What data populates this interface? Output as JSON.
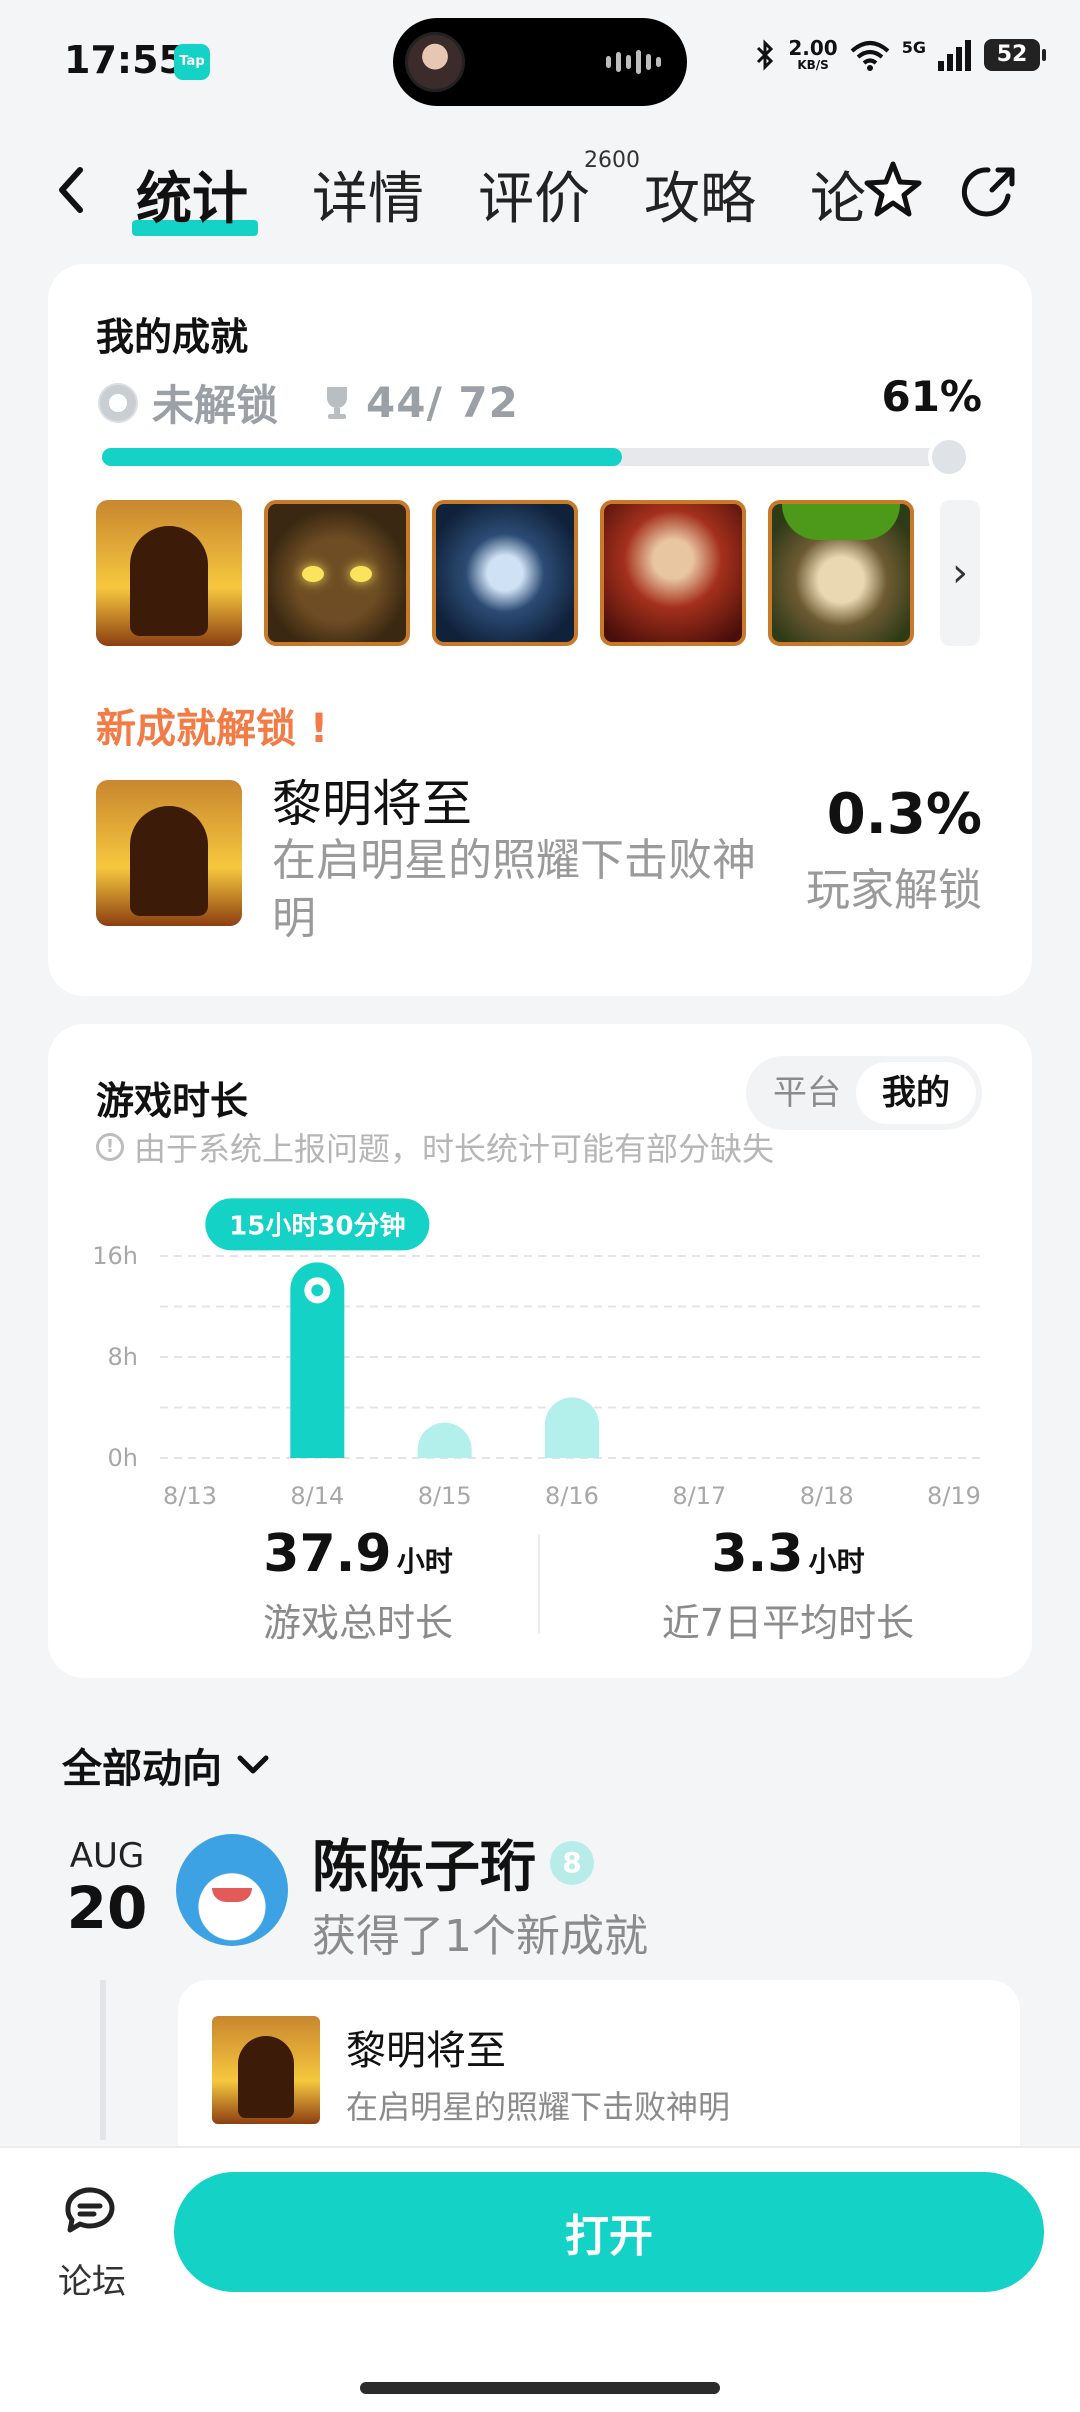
{
  "status_bar": {
    "time": "17:55",
    "app_badge": "Tap",
    "speed": "2.00",
    "speed_unit": "KB/S",
    "network": "5G",
    "battery": "52"
  },
  "nav": {
    "tabs": [
      "统计",
      "详情",
      "评价",
      "攻略",
      "论"
    ],
    "active_tab": "统计",
    "review_count": "2600"
  },
  "achievements": {
    "title": "我的成就",
    "status_label": "未解锁",
    "progress_text": "44/ 72",
    "percent_text": "61%",
    "progress_value": 0.61,
    "badges": [
      "dawn-badge",
      "golem-badge",
      "armor-badge",
      "staff-badge",
      "monkey-badge"
    ],
    "new_title": "新成就解锁 !",
    "new_name": "黎明将至",
    "new_desc": "在启明星的照耀下击败神明",
    "new_rate": "0.3%",
    "new_rate_label": "玩家解锁"
  },
  "playtime": {
    "title": "游戏时长",
    "toggle_off": "平台",
    "toggle_on": "我的",
    "notice": "由于系统上报问题，时长统计可能有部分缺失",
    "total_value": "37.9",
    "total_unit": "小时",
    "total_label": "游戏总时长",
    "avg_value": "3.3",
    "avg_unit": "小时",
    "avg_label": "近7日平均时长"
  },
  "chart_data": {
    "type": "bar",
    "categories": [
      "8/13",
      "8/14",
      "8/15",
      "8/16",
      "8/17",
      "8/18",
      "8/19"
    ],
    "values": [
      0,
      15.5,
      2.8,
      4.8,
      0,
      0,
      0
    ],
    "y_ticks": [
      "16h",
      "8h",
      "0h"
    ],
    "ylim": [
      0,
      16
    ],
    "highlight_index": 1,
    "tooltip": "15小时30分钟",
    "colors": {
      "highlight": "#14d3c6",
      "normal": "#b3f0eb"
    }
  },
  "feed": {
    "header": "全部动向",
    "month": "AUG",
    "day": "20",
    "user": "陈陈子珩",
    "level": "8",
    "action": "获得了1个新成就",
    "card_name": "黎明将至",
    "card_desc": "在启明星的照耀下击败神明"
  },
  "bottom": {
    "forum_label": "论坛",
    "open_label": "打开"
  },
  "colors": {
    "accent": "#14d3c6",
    "new_achievement": "#f37b45"
  }
}
